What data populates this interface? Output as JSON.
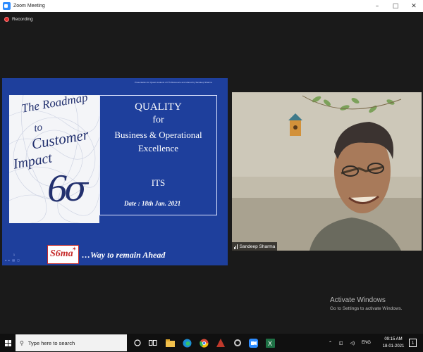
{
  "window": {
    "title": "Zoom Meeting",
    "controls": [
      "–",
      "□",
      "✕"
    ]
  },
  "recording": {
    "label": "Recording"
  },
  "slide": {
    "header_note": "Presentation for Quest students of ITS Mussoorie and shared by Sandeep Sharma",
    "logo_lines": [
      "The Roadmap",
      "to",
      "Customer",
      "Impact"
    ],
    "logo_six": "6",
    "logo_sigma": "σ",
    "title": "QUALITY",
    "for": "for",
    "subtitle_line1": "Business & Operational",
    "subtitle_line2": "Excellence",
    "org": "ITS",
    "date": "Date    : 18th Jan. 2021",
    "brand_logo_text": "S6ma",
    "tagline": "…Way to remain Ahead",
    "page_number": "1",
    "slide_controls": "◂ ▸ ▤ ▢"
  },
  "video": {
    "participant_name": "Sandeep Sharma"
  },
  "watermark": {
    "line1": "Activate Windows",
    "line2": "Go to Settings to activate Windows."
  },
  "taskbar": {
    "search_placeholder": "Type here to search",
    "language": "ENG",
    "time": "09:15 AM",
    "date": "18-01-2021",
    "notification_count": "1",
    "icons": [
      "task-view-icon",
      "cortana-icon",
      "file-explorer-icon",
      "edge-icon",
      "chrome-icon",
      "zoom-icon",
      "word-icon",
      "excel-icon"
    ]
  }
}
